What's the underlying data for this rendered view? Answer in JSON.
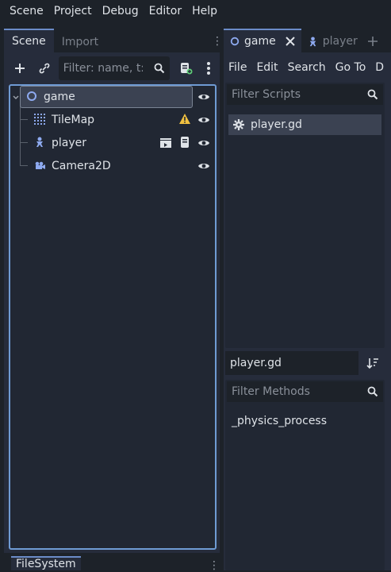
{
  "menubar": {
    "items": [
      "Scene",
      "Project",
      "Debug",
      "Editor",
      "Help"
    ]
  },
  "scene_dock": {
    "tabs": [
      {
        "label": "Scene",
        "active": true
      },
      {
        "label": "Import",
        "active": false
      }
    ],
    "filter_placeholder": "Filter: name, t:t",
    "nodes": [
      {
        "label": "game",
        "icon": "node2d-icon",
        "selected": true,
        "has_warning": false
      },
      {
        "label": "TileMap",
        "icon": "tilemap-icon",
        "selected": false,
        "has_warning": true
      },
      {
        "label": "player",
        "icon": "character-icon",
        "selected": false,
        "has_warning": false
      },
      {
        "label": "Camera2D",
        "icon": "camera-icon",
        "selected": false,
        "has_warning": false
      }
    ]
  },
  "bottom_dock": {
    "tab_label": "FileSystem"
  },
  "editor_tabs": [
    {
      "label": "game",
      "active": true
    },
    {
      "label": "player",
      "active": false
    }
  ],
  "script_menu": [
    "File",
    "Edit",
    "Search",
    "Go To",
    "D"
  ],
  "script_list": {
    "filter_placeholder": "Filter Scripts",
    "items": [
      "player.gd"
    ]
  },
  "method_panel": {
    "current_script": "player.gd",
    "filter_placeholder": "Filter Methods",
    "methods": [
      "_physics_process"
    ]
  },
  "colors": {
    "accent": "#6f9bd4",
    "warning": "#f0c040",
    "node_blue": "#8eaaf0"
  }
}
